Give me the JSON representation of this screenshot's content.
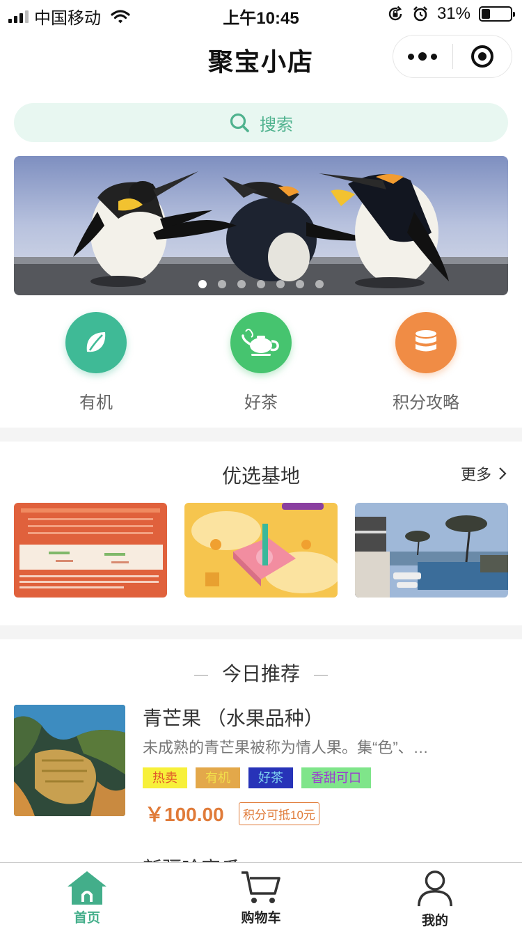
{
  "status_bar": {
    "carrier": "中国移动",
    "time": "上午10:45",
    "battery": "31%",
    "battery_level": 0.31
  },
  "nav": {
    "title": "聚宝小店"
  },
  "search": {
    "placeholder": "搜索"
  },
  "banner": {
    "indicator_count": 7,
    "active_index": 0
  },
  "categories": [
    {
      "label": "有机",
      "icon": "leaf-icon",
      "color": "#3fba96"
    },
    {
      "label": "好茶",
      "icon": "teapot-icon",
      "color": "#46c46f"
    },
    {
      "label": "积分攻略",
      "icon": "database-icon",
      "color": "#f08c45"
    }
  ],
  "base_section": {
    "title": "优选基地",
    "more": "更多"
  },
  "recommend": {
    "title": "今日推荐",
    "items": [
      {
        "name": "青芒果 （水果品种）",
        "desc": "未成熟的青芒果被称为情人果。集“色”、…",
        "tags": [
          {
            "label": "热卖",
            "bg": "#f7f03a",
            "color": "#e05a2a"
          },
          {
            "label": "有机",
            "bg": "#e3a84a",
            "color": "#f2e04a"
          },
          {
            "label": "好茶",
            "bg": "#2733b8",
            "color": "#7fd3f0"
          },
          {
            "label": "香甜可口",
            "bg": "#7fe58a",
            "color": "#9b3bd1"
          }
        ],
        "price": "￥100.00",
        "points": "积分可抵10元"
      },
      {
        "name": "新疆哈密瓜"
      }
    ]
  },
  "tabbar": {
    "items": [
      {
        "label": "首页",
        "active": true
      },
      {
        "label": "购物车",
        "active": false
      },
      {
        "label": "我的",
        "active": false
      }
    ]
  },
  "colors": {
    "accent": "#43ae8a",
    "price": "#e07b39"
  }
}
